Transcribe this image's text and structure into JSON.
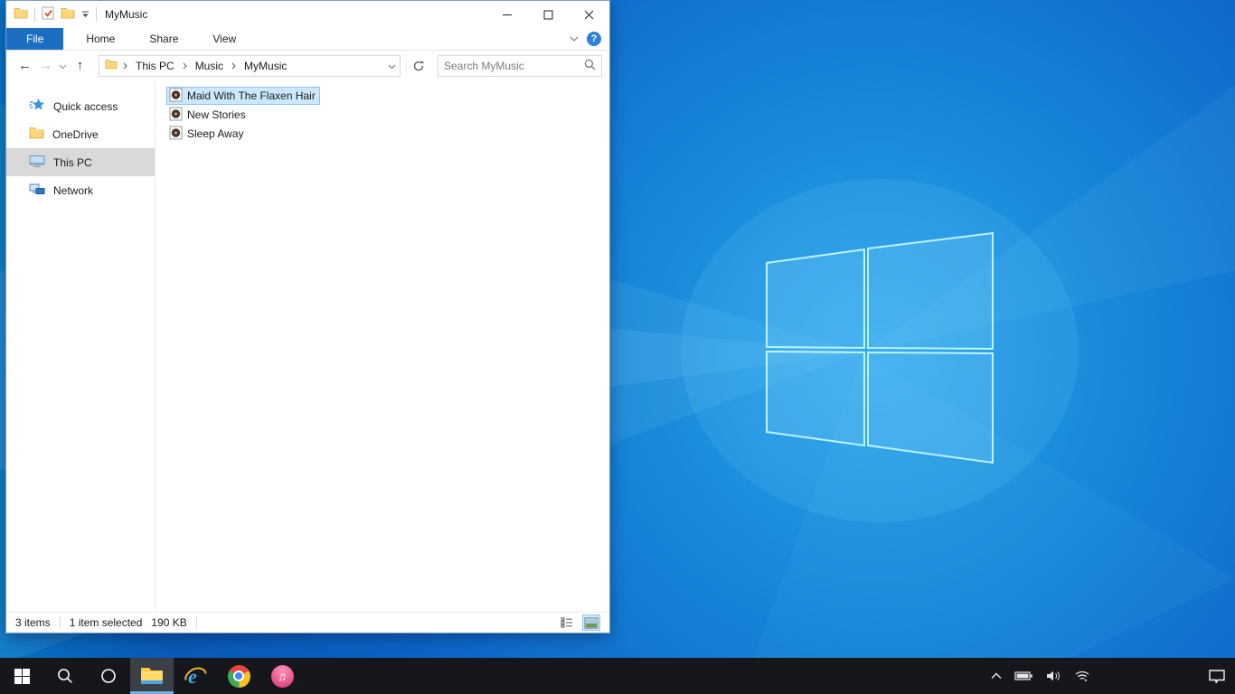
{
  "colors": {
    "accent_blue": "#1b6ec2",
    "selection_bg": "#cce8ff",
    "selection_border": "#8fc2ef",
    "sidebar_selected_bg": "#d9d9d9",
    "taskbar_bg": "#15171c",
    "taskbar_active_underline": "#6fb2e4",
    "wallpaper_center": "#2ba2ea",
    "wallpaper_edge": "#0953ae",
    "folder_yellow": "#ffd77b"
  },
  "window": {
    "title": "MyMusic",
    "tabs": [
      "File",
      "Home",
      "Share",
      "View"
    ],
    "breadcrumb": [
      "This PC",
      "Music",
      "MyMusic"
    ],
    "search_placeholder": "Search MyMusic",
    "sidebar": {
      "items": [
        {
          "label": "Quick access",
          "icon": "quick-access-star"
        },
        {
          "label": "OneDrive",
          "icon": "onedrive-folder"
        },
        {
          "label": "This PC",
          "icon": "monitor",
          "selected": true
        },
        {
          "label": "Network",
          "icon": "network-computers"
        }
      ]
    },
    "files": {
      "items": [
        {
          "name": "Maid With The Flaxen Hair",
          "icon": "audio-file",
          "selected": true
        },
        {
          "name": "New Stories",
          "icon": "audio-file",
          "selected": false
        },
        {
          "name": "Sleep Away",
          "icon": "audio-file",
          "selected": false
        }
      ]
    },
    "statusbar": {
      "item_count": "3 items",
      "selection": "1 item selected",
      "selection_size": "190 KB"
    }
  },
  "taskbar": {
    "buttons": [
      "start",
      "search",
      "cortana",
      "file-explorer (active)",
      "internet-explorer",
      "chrome",
      "itunes"
    ],
    "tray": [
      "hidden-icons-chevron",
      "battery",
      "volume",
      "wifi"
    ],
    "action_center": "action-center"
  },
  "icons": {
    "search": "magnifier glyph",
    "refresh": "circular arrow",
    "back": "left arrow",
    "forward": "right arrow",
    "up": "up arrow",
    "help": "question mark in blue circle",
    "audio-file": "page with dark disc",
    "folder": "yellow folder",
    "properties": "page with red check",
    "qat-dropdown": "overlined down caret",
    "view-details": "list rows",
    "view-thumbnails": "picture thumbnail"
  }
}
